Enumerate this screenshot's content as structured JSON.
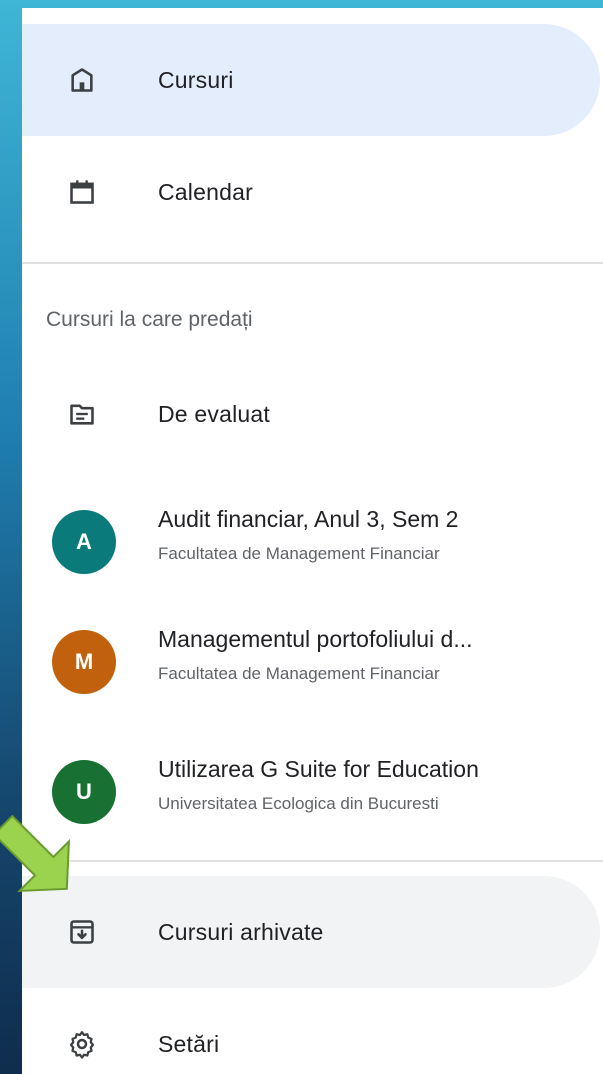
{
  "nav": {
    "courses_label": "Cursuri",
    "calendar_label": "Calendar"
  },
  "teaching": {
    "section_title": "Cursuri la care predați",
    "to_review_label": "De evaluat",
    "courses": [
      {
        "avatar_letter": "A",
        "avatar_color": "#0b7a7a",
        "title": "Audit financiar, Anul 3, Sem 2",
        "subtitle": "Facultatea de Management Financiar"
      },
      {
        "avatar_letter": "M",
        "avatar_color": "#c2610d",
        "title": "Managementul portofoliului d...",
        "subtitle": "Facultatea de Management Financiar"
      },
      {
        "avatar_letter": "U",
        "avatar_color": "#187032",
        "title": "Utilizarea G Suite for Education",
        "subtitle": "Universitatea Ecologica din Bucuresti"
      }
    ]
  },
  "footer_nav": {
    "archived_label": "Cursuri arhivate",
    "settings_label": "Setări"
  },
  "colors": {
    "active_bg": "#e3edfb",
    "hover_bg": "#f1f3f4",
    "arrow_fill": "#9bd24e",
    "icon_color": "#3c4043"
  },
  "icons": {
    "home": "home-icon",
    "calendar": "calendar-icon",
    "to_review": "folder-icon",
    "archive": "archive-icon",
    "settings": "gear-icon",
    "arrow": "arrow-pointer-icon"
  }
}
